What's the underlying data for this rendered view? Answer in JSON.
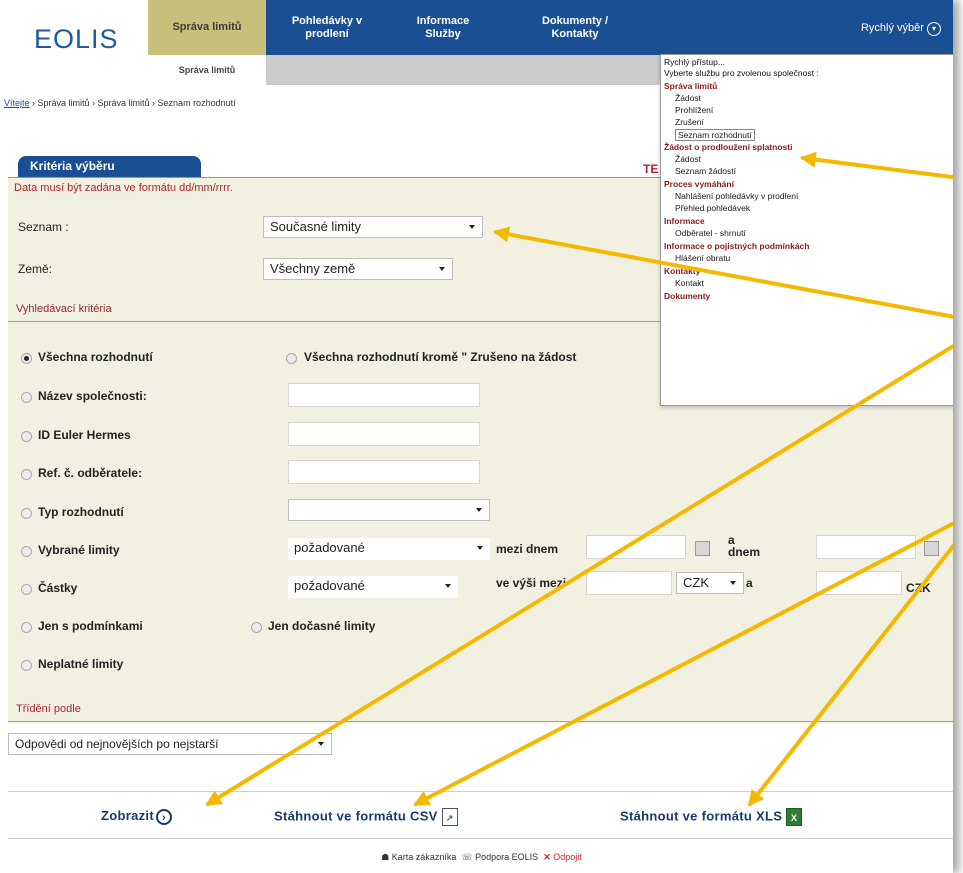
{
  "header": {
    "logo": "EOLIS",
    "tabs": [
      {
        "label": "Správa limitů",
        "active": true
      },
      {
        "label": "Pohledávky v\nprodlení"
      },
      {
        "label": "Informace\nSlužby"
      },
      {
        "label": "Dokumenty /\nKontakty"
      }
    ],
    "rychly": "Rychlý výběr",
    "subnav_active": "Správa limitů"
  },
  "breadcrumb": {
    "home": "Vítejte",
    "rest": " › Správa limitů › Správa limitů › Seznam rozhodnutí"
  },
  "quick_menu": {
    "title": "Rychlý přístup...",
    "subtitle": "Vyberte službu pro zvolenou společnost :",
    "groups": [
      {
        "label": "Správa limitů",
        "items": [
          "Žádost",
          "Prohlížení",
          "Zrušení",
          "Seznam rozhodnutí"
        ]
      },
      {
        "label": "Žádost o prodloužení splatnosti",
        "items": [
          "Žádost",
          "Seznam žádostí"
        ]
      },
      {
        "label": "Proces vymáhání",
        "items": [
          "Nahlášení pohledávky v prodlení",
          "Přehled pohledávek"
        ]
      },
      {
        "label": "Informace",
        "items": [
          "Odběratel - shrnutí"
        ]
      },
      {
        "label": "Informace o pojistných podmínkách",
        "items": [
          "Hlášení obratu"
        ]
      },
      {
        "label": "Kontakty",
        "items": [
          "Kontakt"
        ]
      },
      {
        "label": "Dokumenty",
        "items": []
      }
    ]
  },
  "panel": {
    "title": "Kritéria výběru",
    "te": "TE",
    "notice": "Data musí být zadána ve formátu dd/mm/rrrr.",
    "seznam_label": "Seznam :",
    "seznam_value": "Současné limity",
    "zeme_label": "Země:",
    "zeme_value": "Všechny země",
    "search_header": "Vyhledávací kritéria",
    "options": {
      "all": "Všechna rozhodnutí",
      "all_except": "Všechna rozhodnutí kromě \" Zrušeno na žádost",
      "company_name": "Název společnosti:",
      "euler_id": "ID Euler Hermes",
      "ref": "Ref. č. odběratele:",
      "type": "Typ rozhodnutí",
      "limits": "Vybrané limity",
      "amounts": "Částky",
      "only_conditions": "Jen s podmínkami",
      "only_temporary": "Jen dočasné limity",
      "invalid": "Neplatné limity"
    },
    "limits_select": "požadované",
    "between_label": "mezi dnem",
    "and_day": "a\ndnem",
    "amounts_select": "požadované",
    "range_label": "ve výši mezi",
    "currency": "CZK",
    "and": "a",
    "currency2": "CZK",
    "sort_header": "Třídění podle",
    "sort_value": "Odpovědi od nejnovějších po nejstarší"
  },
  "actions": {
    "show": "Zobrazit",
    "csv": "Stáhnout ve formátu CSV",
    "xls": "Stáhnout ve formátu XLS"
  },
  "footer": {
    "card": "Karta zákazníka",
    "support": "Podpora EOLIS",
    "logout": "Odpojit"
  },
  "colors": {
    "brand_blue": "#1a4f93",
    "active_tab": "#c8bf7a",
    "panel_bg": "#f2f0e0",
    "accent_red": "#b0232f",
    "annotation_arrow": "#f5b800"
  }
}
